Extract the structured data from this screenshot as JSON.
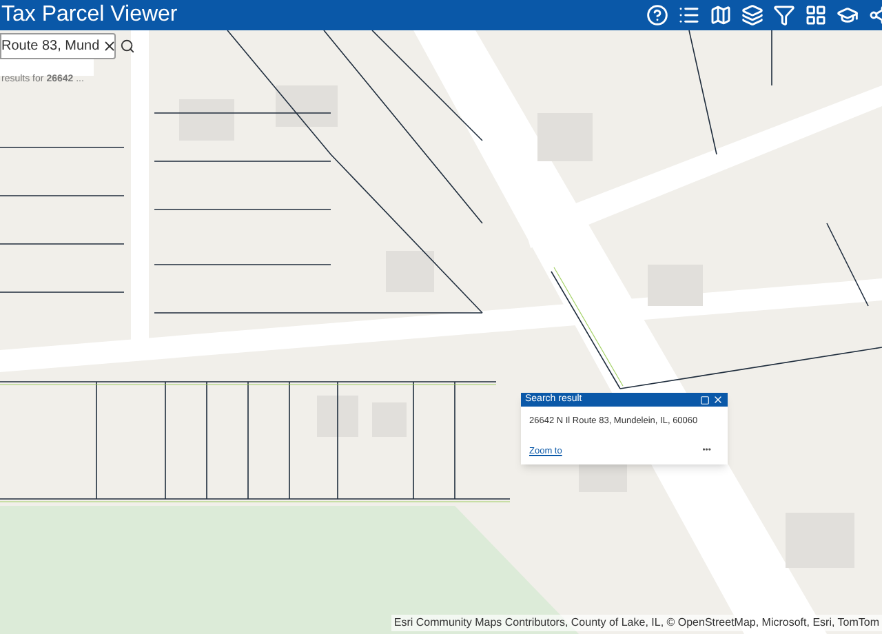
{
  "header": {
    "title": "Tax Parcel Viewer"
  },
  "search": {
    "value": "Route 83, Mund",
    "results": "results for **26642** ..."
  },
  "popup": {
    "title": "Search result",
    "address": "26642 N Il Route 83, Mundelein, IL, 60060",
    "link": "Zoom to",
    "more": "•••"
  },
  "attribution": "Esri Community Maps Contributors, County of Lake, IL, © OpenStreetMap, Microsoft, Esri, TomTom"
}
